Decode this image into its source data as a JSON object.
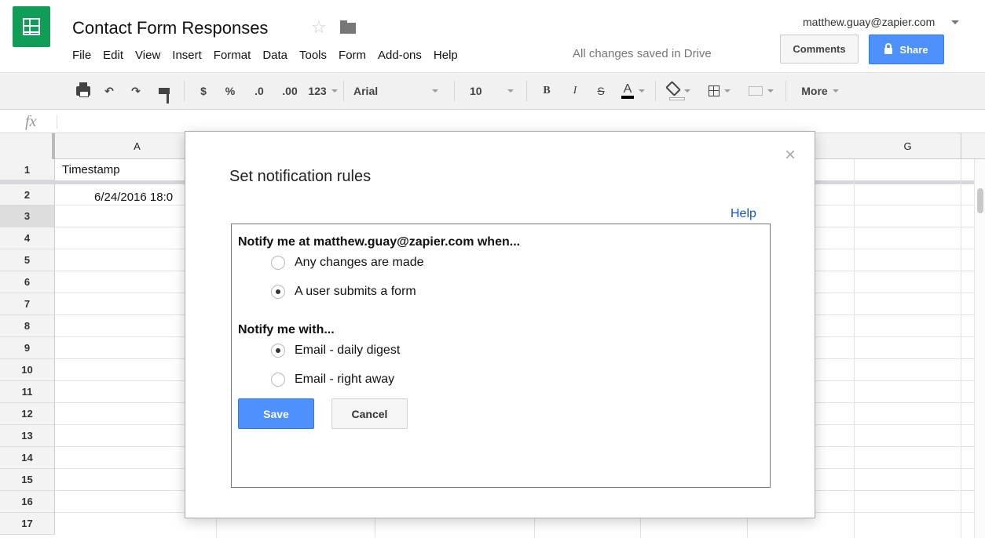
{
  "app": {
    "doc_title": "Contact Form Responses",
    "save_status": "All changes saved in Drive",
    "account_email": "matthew.guay@zapier.com",
    "brand_color": "#0f9d58",
    "accent_color": "#4d90fe"
  },
  "menu": {
    "items": [
      "File",
      "Edit",
      "View",
      "Insert",
      "Format",
      "Data",
      "Tools",
      "Form",
      "Add-ons",
      "Help"
    ]
  },
  "header": {
    "comments_label": "Comments",
    "share_label": "Share"
  },
  "toolbar": {
    "currency": "$",
    "percent": "%",
    "decrease_decimals": ".0",
    "increase_decimals": ".00",
    "more_formats": "123",
    "font": "Arial",
    "font_size": "10",
    "bold": "B",
    "italic": "I",
    "strike": "S",
    "text_color": "A",
    "more": "More",
    "icons": [
      "print-icon",
      "undo-icon",
      "redo-icon",
      "paint-format-icon",
      "fill-color-icon",
      "borders-icon",
      "merge-cells-icon"
    ]
  },
  "formula_bar": {
    "fx": "fx"
  },
  "sheet": {
    "columns": [
      "A",
      "G"
    ],
    "rows": [
      "1",
      "2",
      "3",
      "4",
      "5",
      "6",
      "7",
      "8",
      "9",
      "10",
      "11",
      "12",
      "13",
      "14",
      "15",
      "16",
      "17"
    ],
    "selected_row": "3",
    "cells": {
      "a1": "Timestamp",
      "a2": "6/24/2016 18:0"
    }
  },
  "dialog": {
    "title": "Set notification rules",
    "help": "Help",
    "close": "×",
    "when_label": "Notify me at matthew.guay@zapier.com when...",
    "when_options": [
      {
        "label": "Any changes are made",
        "checked": false
      },
      {
        "label": "A user submits a form",
        "checked": true
      }
    ],
    "with_label": "Notify me with...",
    "with_options": [
      {
        "label": "Email - daily digest",
        "checked": true
      },
      {
        "label": "Email - right away",
        "checked": false
      }
    ],
    "save_label": "Save",
    "cancel_label": "Cancel"
  }
}
